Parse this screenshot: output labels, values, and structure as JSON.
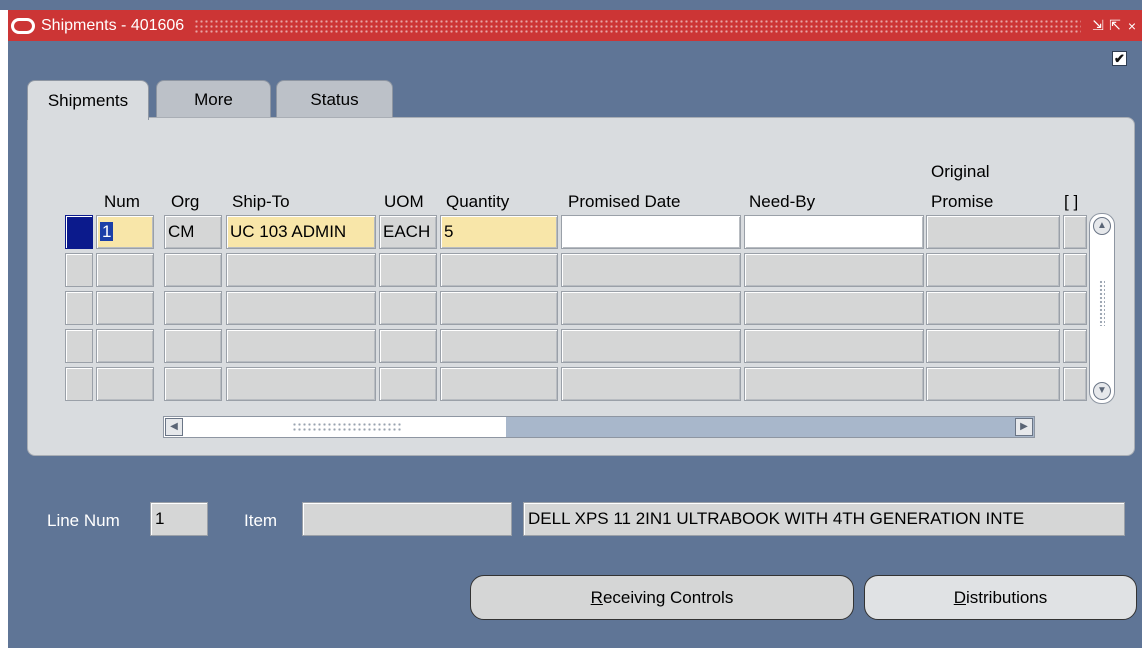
{
  "window": {
    "title": "Shipments - 401606",
    "check_glyph": "✔",
    "controls": [
      "⇲",
      "⇱",
      "×"
    ]
  },
  "tabs": [
    {
      "label": "Shipments",
      "active": true
    },
    {
      "label": "More",
      "active": false
    },
    {
      "label": "Status",
      "active": false
    }
  ],
  "table": {
    "headers": {
      "num": "Num",
      "org": "Org",
      "ship_to": "Ship-To",
      "uom": "UOM",
      "quantity": "Quantity",
      "promised_date": "Promised Date",
      "need_by": "Need-By",
      "original_promise_line1": "Original",
      "original_promise_line2": "Promise",
      "folder": "[ ]"
    },
    "rows": [
      {
        "num": "1",
        "org": "CM",
        "ship_to": "UC 103 ADMIN",
        "uom": "EACH",
        "quantity": "5",
        "promised_date": "",
        "need_by": "",
        "original_promise": ""
      },
      {
        "num": "",
        "org": "",
        "ship_to": "",
        "uom": "",
        "quantity": "",
        "promised_date": "",
        "need_by": "",
        "original_promise": ""
      },
      {
        "num": "",
        "org": "",
        "ship_to": "",
        "uom": "",
        "quantity": "",
        "promised_date": "",
        "need_by": "",
        "original_promise": ""
      },
      {
        "num": "",
        "org": "",
        "ship_to": "",
        "uom": "",
        "quantity": "",
        "promised_date": "",
        "need_by": "",
        "original_promise": ""
      },
      {
        "num": "",
        "org": "",
        "ship_to": "",
        "uom": "",
        "quantity": "",
        "promised_date": "",
        "need_by": "",
        "original_promise": ""
      }
    ]
  },
  "footer": {
    "line_num_label": "Line Num",
    "line_num_value": "1",
    "item_label": "Item",
    "item_value": "",
    "item_description": "DELL XPS 11 2IN1 ULTRABOOK WITH 4TH GENERATION INTE"
  },
  "buttons": {
    "receiving_controls_mnemonic": "R",
    "receiving_controls_rest": "eceiving Controls",
    "distributions_mnemonic": "D",
    "distributions_rest": "istributions"
  },
  "colors": {
    "background": "#5f7596",
    "titlebar": "#cc3535",
    "required_field": "#f8e6a9",
    "current_row": "#0b1a8c"
  }
}
